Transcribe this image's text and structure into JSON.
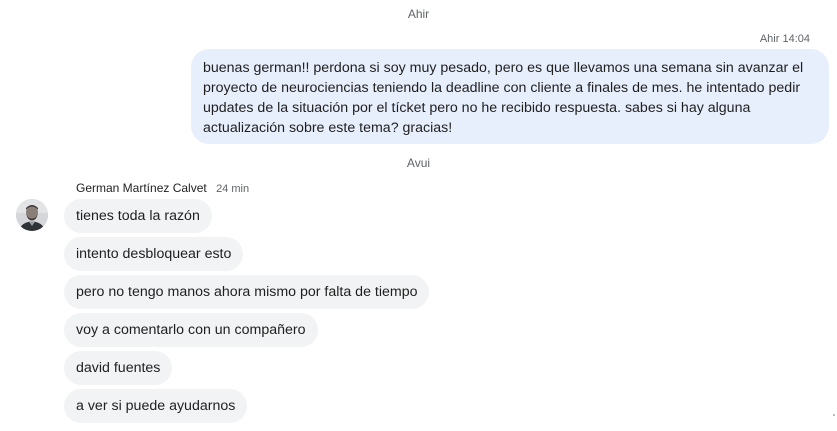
{
  "separators": {
    "yesterday": "Ahir",
    "today": "Avui"
  },
  "outgoing": {
    "time": "Ahir 14:04",
    "text": "buenas german!! perdona si soy muy pesado, pero es que llevamos una semana sin avanzar el proyecto de neurociencias teniendo la deadline con cliente a finales de mes. he intentado pedir updates de la situación por el tícket pero no he recibido respuesta. sabes si hay alguna actualización sobre este tema? gracias!",
    "bubble_color": "#e8effc"
  },
  "incoming": {
    "sender": "German Martínez Calvet",
    "time": "24 min",
    "bubble_color": "#f1f3f4",
    "messages": [
      "tienes toda la razón",
      "intento desbloquear esto",
      "pero no tengo manos ahora mismo por falta de tiempo",
      "voy a comentarlo con un compañero",
      "david fuentes",
      "a ver si puede ayudarnos"
    ]
  }
}
